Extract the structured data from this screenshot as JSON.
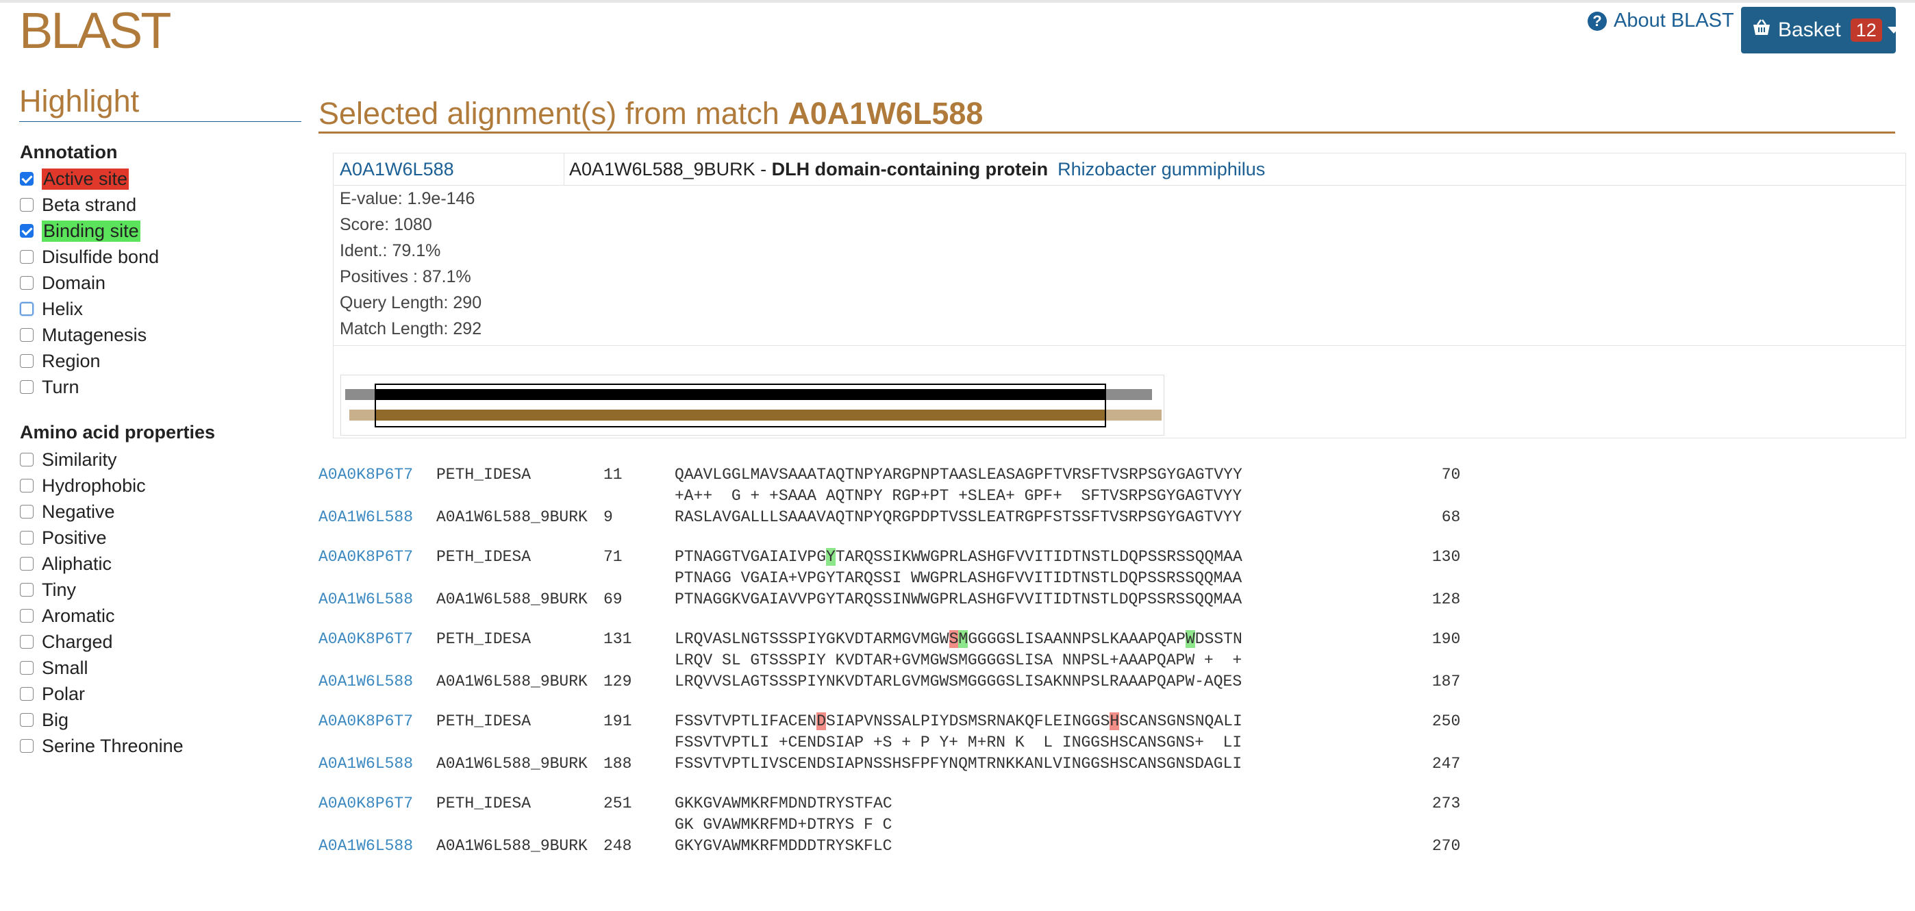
{
  "header": {
    "brand": "BLAST",
    "about_label": "About BLAST",
    "basket_label": "Basket",
    "basket_count": "12"
  },
  "sidebar": {
    "title": "Highlight",
    "annotation_heading": "Annotation",
    "annotation": [
      {
        "label": "Active site",
        "checked": true,
        "highlight": "#e0392b"
      },
      {
        "label": "Beta strand",
        "checked": false
      },
      {
        "label": "Binding site",
        "checked": true,
        "highlight": "#5be35b"
      },
      {
        "label": "Disulfide bond",
        "checked": false
      },
      {
        "label": "Domain",
        "checked": false
      },
      {
        "label": "Helix",
        "checked": false
      },
      {
        "label": "Mutagenesis",
        "checked": false
      },
      {
        "label": "Region",
        "checked": false
      },
      {
        "label": "Turn",
        "checked": false
      }
    ],
    "amino_heading": "Amino acid properties",
    "amino": [
      {
        "label": "Similarity"
      },
      {
        "label": "Hydrophobic"
      },
      {
        "label": "Negative"
      },
      {
        "label": "Positive"
      },
      {
        "label": "Aliphatic"
      },
      {
        "label": "Tiny"
      },
      {
        "label": "Aromatic"
      },
      {
        "label": "Charged"
      },
      {
        "label": "Small"
      },
      {
        "label": "Polar"
      },
      {
        "label": "Big"
      },
      {
        "label": "Serine Threonine"
      }
    ]
  },
  "main": {
    "title_prefix": "Selected alignment(s) from match",
    "title_accession": "A0A1W6L588",
    "match": {
      "accession": "A0A1W6L588",
      "entry": "A0A1W6L588_9BURK - ",
      "protein": "DLH domain-containing protein",
      "organism": "Rhizobacter gummiphilus"
    },
    "stats": [
      "E-value: 1.9e-146",
      "Score: 1080",
      "Ident.: 79.1%",
      "Positives : 87.1%",
      "Query Length: 290",
      "Match Length: 292"
    ],
    "graph": {
      "query_length": 290,
      "match_length": 292,
      "query_start": 11,
      "query_end": 273,
      "match_start": 9,
      "match_end": 270
    }
  },
  "alignment": [
    {
      "q_acc": "A0A0K8P6T7",
      "q_name": "PETH_IDESA",
      "q_start": "11",
      "q_seq": "QAAVLGGLMAVSAAATAQTNPYARGPNPTAASLEASAGPFTVRSFTVSRPSGYGAGTVYY",
      "q_end": "70",
      "mid": "+A++  G + +SAAA AQTNPY RGP+PT +SLEA+ GPF+  SFTVSRPSGYGAGTVYY",
      "s_acc": "A0A1W6L588",
      "s_name": "A0A1W6L588_9BURK",
      "s_start": "9",
      "s_seq": "RASLAVGALLLSAAAVAQTNPYQRGPDPTVSSLEATRGPFSTSSFTVSRPSGYGAGTVYY",
      "s_end": "68",
      "marks": []
    },
    {
      "q_acc": "A0A0K8P6T7",
      "q_name": "PETH_IDESA",
      "q_start": "71",
      "q_seq": "PTNAGGTVGAIAIVPGYTARQSSIKWWGPRLASHGFVVITIDTNSTLDQPSSRSSQQMAA",
      "q_end": "130",
      "mid": "PTNAGG VGAIA+VPGYTARQSSI WWGPRLASHGFVVITIDTNSTLDQPSSRSSQQMAA",
      "s_acc": "A0A1W6L588",
      "s_name": "A0A1W6L588_9BURK",
      "s_start": "69",
      "s_seq": "PTNAGGKVGAIAVVPGYTARQSSINWWGPRLASHGFVVITIDTNSTLDQPSSRSSQQMAA",
      "s_end": "128",
      "marks": [
        {
          "i": 16,
          "c": "g"
        }
      ]
    },
    {
      "q_acc": "A0A0K8P6T7",
      "q_name": "PETH_IDESA",
      "q_start": "131",
      "q_seq": "LRQVASLNGTSSSPIYGKVDTARMGVMGWSMGGGGSLISAANNPSLKAAAPQAPWDSSTN",
      "q_end": "190",
      "mid": "LRQV SL GTSSSPIY KVDTAR+GVMGWSMGGGGSLISA NNPSL+AAAPQAPW +  +",
      "s_acc": "A0A1W6L588",
      "s_name": "A0A1W6L588_9BURK",
      "s_start": "129",
      "s_seq": "LRQVVSLAGTSSSPIYNKVDTARLGVMGWSMGGGGSLISAKNNPSLRAAAPQAPW-AQES",
      "s_end": "187",
      "marks": [
        {
          "i": 29,
          "c": "r"
        },
        {
          "i": 30,
          "c": "g"
        },
        {
          "i": 54,
          "c": "g"
        }
      ]
    },
    {
      "q_acc": "A0A0K8P6T7",
      "q_name": "PETH_IDESA",
      "q_start": "191",
      "q_seq": "FSSVTVPTLIFACENDSIAPVNSSALPIYDSMSRNAKQFLEINGGSHSCANSGNSNQALI",
      "q_end": "250",
      "mid": "FSSVTVPTLI +CENDSIAP +S + P Y+ M+RN K  L INGGSHSCANSGNS+  LI",
      "s_acc": "A0A1W6L588",
      "s_name": "A0A1W6L588_9BURK",
      "s_start": "188",
      "s_seq": "FSSVTVPTLIVSCENDSIAPNSSHSFPFYNQMTRNKKANLVINGGSHSCANSGNSDAGLI",
      "s_end": "247",
      "marks": [
        {
          "i": 15,
          "c": "r"
        },
        {
          "i": 46,
          "c": "r"
        }
      ]
    },
    {
      "q_acc": "A0A0K8P6T7",
      "q_name": "PETH_IDESA",
      "q_start": "251",
      "q_seq": "GKKGVAWMKRFMDNDTRYSTFAC",
      "q_end": "273",
      "mid": "GK GVAWMKRFMD+DTRYS F C",
      "s_acc": "A0A1W6L588",
      "s_name": "A0A1W6L588_9BURK",
      "s_start": "248",
      "s_seq": "GKYGVAWMKRFMDDDTRYSKFLC",
      "s_end": "270",
      "marks": []
    }
  ]
}
